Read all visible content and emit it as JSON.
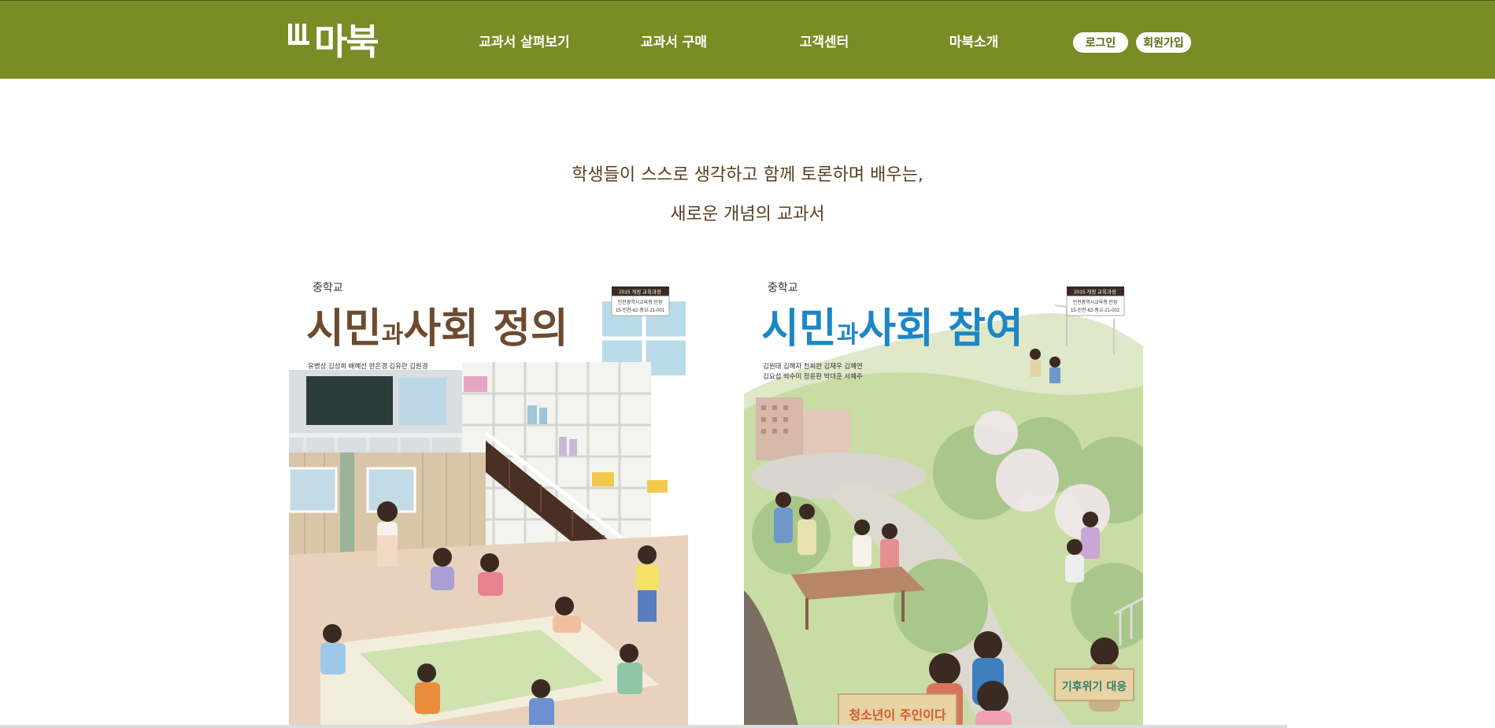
{
  "header": {
    "logo_text": "마북",
    "brand_color": "#7a8c25",
    "nav": [
      {
        "label": "교과서 살펴보기"
      },
      {
        "label": "교과서 구매"
      },
      {
        "label": "고객센터"
      },
      {
        "label": "마북소개"
      }
    ],
    "login_label": "로그인",
    "signup_label": "회원가입"
  },
  "tagline": {
    "line1": "학생들이 스스로 생각하고 함께 토론하며 배우는,",
    "line2": "새로운 개념의 교과서"
  },
  "books": [
    {
      "level": "중학교",
      "title_part1": "시민",
      "title_small": "과",
      "title_part2": "사회 정의",
      "authors_line1": "유병상  김성희  배혜선  한은경  김유란  김원경",
      "authors_line2": "",
      "badge_title": "2015 개정 교육과정",
      "badge_line1": "인천광역시교육청 인정",
      "badge_line2": "15-인천-62-중교-21-001",
      "title_color": "#6e4a2e"
    },
    {
      "level": "중학교",
      "title_part1": "시민",
      "title_small": "과",
      "title_part2": "사회 참여",
      "authors_line1": "김원태  김혜자  천희완  김재우  김혜연",
      "authors_line2": "김요섭  박수미  정윤환  박대훈  서혜주",
      "badge_title": "2015 개정 교육과정",
      "badge_line1": "인천광역시교육청 인정",
      "badge_line2": "15-인천-62-중교-21-002",
      "title_color": "#1d86c6",
      "sign_text_1": "기후위기 대응",
      "sign_text_2": "청소년이 주인이다"
    }
  ]
}
